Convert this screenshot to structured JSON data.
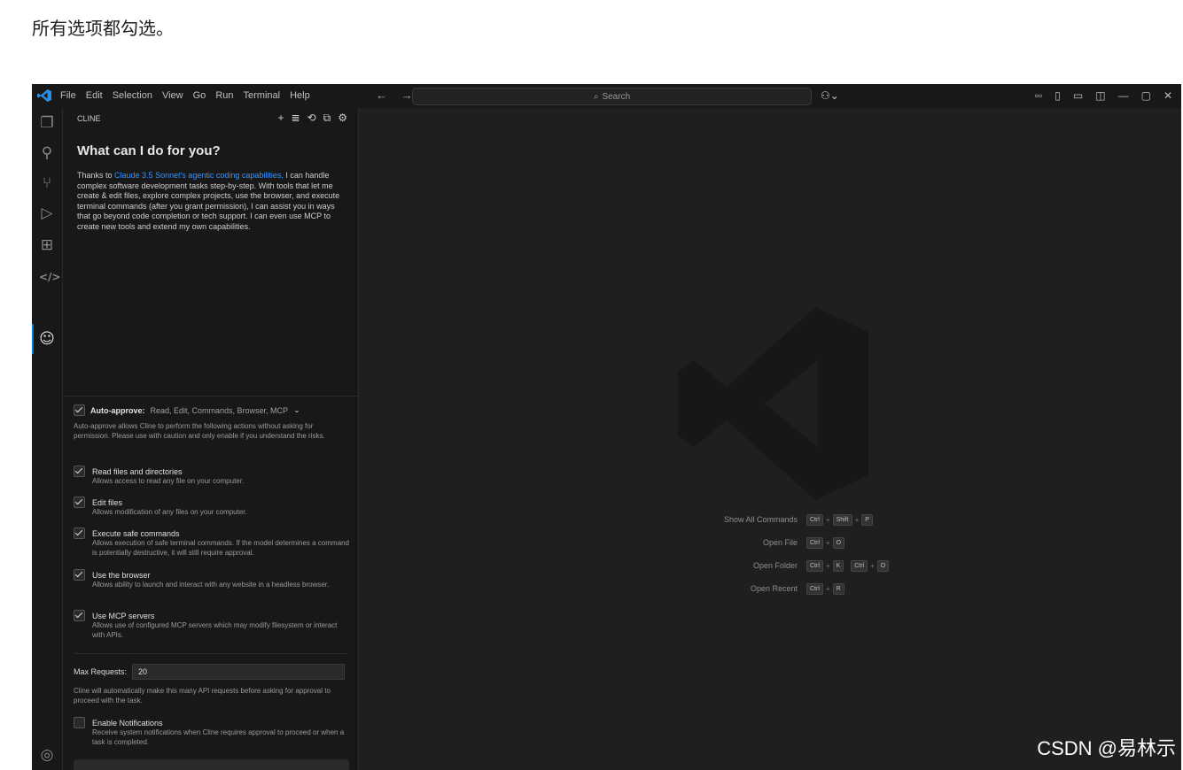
{
  "caption": "所有选项都勾选。",
  "watermark": "CSDN @易林示",
  "titlebar": {
    "menu": [
      "File",
      "Edit",
      "Selection",
      "View",
      "Go",
      "Run",
      "Terminal",
      "Help"
    ],
    "nav": "← →",
    "search_placeholder": "Search",
    "copilot": "⚇⌄",
    "window_controls": [
      "▫▫",
      "▯",
      "▭",
      "◫",
      "—",
      "▢",
      "✕"
    ]
  },
  "activity_bar": {
    "icons": [
      "explorer-icon",
      "search-icon",
      "source-control-icon",
      "run-debug-icon",
      "extensions-icon",
      "remote-icon",
      "cline-icon",
      "account-icon"
    ]
  },
  "cline": {
    "panel_title": "CLINE",
    "tools": [
      "+",
      "≣",
      "⟲",
      "⧉",
      "⚙"
    ],
    "heading": "What can I do for you?",
    "intro_prefix": "Thanks to ",
    "intro_link": "Claude 3.5 Sonnet's agentic coding capabilities,",
    "intro_rest": " I can handle complex software development tasks step-by-step. With tools that let me create & edit files, explore complex projects, use the browser, and execute terminal commands (after you grant permission), I can assist you in ways that go beyond code completion or tech support. I can even use MCP to create new tools and extend my own capabilities.",
    "auto_approve_label": "Auto-approve:",
    "auto_approve_values": "Read, Edit, Commands, Browser, MCP",
    "auto_approve_desc": "Auto-approve allows Cline to perform the following actions without asking for permission. Please use with caution and only enable if you understand the risks.",
    "options": [
      {
        "label": "Read files and directories",
        "desc": "Allows access to read any file on your computer.",
        "checked": true
      },
      {
        "label": "Edit files",
        "desc": "Allows modification of any files on your computer.",
        "checked": true
      },
      {
        "label": "Execute safe commands",
        "desc": "Allows execution of safe terminal commands. If the model determines a command is potentially destructive, it will still require approval.",
        "checked": true
      },
      {
        "label": "Use the browser",
        "desc": "Allows ability to launch and interact with any website in a headless browser.",
        "checked": true
      },
      {
        "label": "Use MCP servers",
        "desc": "Allows use of configured MCP servers which may modify filesystem or interact with APIs.",
        "checked": true
      }
    ],
    "max_requests_label": "Max Requests:",
    "max_requests_value": "20",
    "max_requests_desc": "Cline will automatically make this many API requests before asking for approval to proceed with the task.",
    "notifications_label": "Enable Notifications",
    "notifications_desc": "Receive system notifications when Cline requires approval to proceed or when a task is completed.",
    "notifications_checked": false
  },
  "editor": {
    "shortcuts": [
      {
        "label": "Show All Commands",
        "keys": [
          "Ctrl",
          "+",
          "Shift",
          "+",
          "P"
        ]
      },
      {
        "label": "Open File",
        "keys": [
          "Ctrl",
          "+",
          "O"
        ]
      },
      {
        "label": "Open Folder",
        "keys": [
          "Ctrl",
          "+",
          "K",
          " ",
          "Ctrl",
          "+",
          "O"
        ]
      },
      {
        "label": "Open Recent",
        "keys": [
          "Ctrl",
          "+",
          "R"
        ]
      }
    ]
  },
  "colors": {
    "accent": "#0078d4",
    "link": "#3794ff",
    "background": "#1f1f1f"
  }
}
